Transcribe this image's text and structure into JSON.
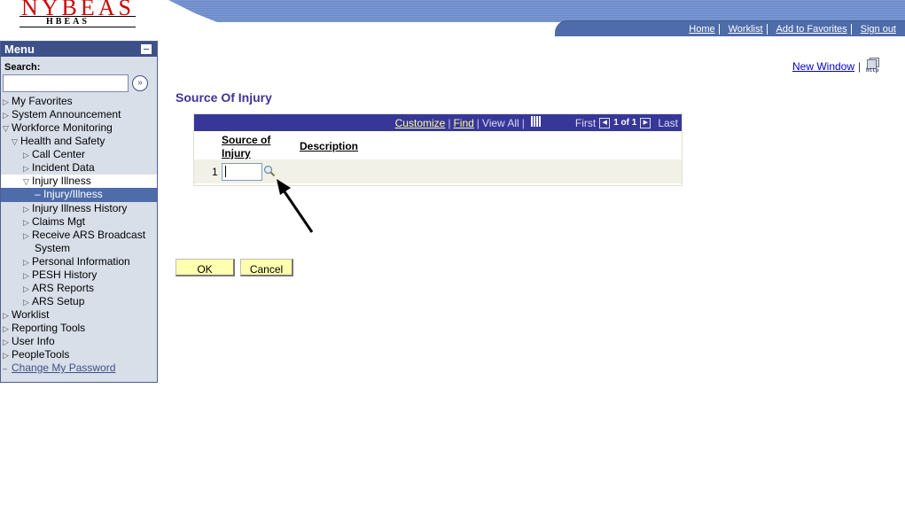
{
  "header": {
    "logo_main": "NYBEAS",
    "logo_sub": "HBEAS",
    "nav_links": [
      "Home",
      "Worklist",
      "Add to Favorites",
      "Sign out"
    ]
  },
  "sidebar": {
    "title": "Menu",
    "search_label": "Search:",
    "search_value": "",
    "items": [
      {
        "label": "My Favorites",
        "level": 0,
        "state": "collapsed"
      },
      {
        "label": "System Announcement",
        "level": 0,
        "state": "collapsed"
      },
      {
        "label": "Workforce Monitoring",
        "level": 0,
        "state": "expanded"
      },
      {
        "label": "Health and Safety",
        "level": 1,
        "state": "expanded"
      },
      {
        "label": "Call Center",
        "level": 2,
        "state": "collapsed"
      },
      {
        "label": "Incident Data",
        "level": 2,
        "state": "collapsed"
      },
      {
        "label": "Injury Illness",
        "level": 2,
        "state": "expanded"
      },
      {
        "label": "Injury/Illness",
        "level": 3,
        "state": "selected"
      },
      {
        "label": "Injury Illness History",
        "level": 2,
        "state": "collapsed"
      },
      {
        "label": "Claims Mgt",
        "level": 2,
        "state": "collapsed"
      },
      {
        "label": "Receive ARS Broadcast",
        "level": 2,
        "state": "collapsed"
      },
      {
        "label": "System",
        "level": 2,
        "state": "continuation"
      },
      {
        "label": "Personal Information",
        "level": 2,
        "state": "collapsed"
      },
      {
        "label": "PESH History",
        "level": 2,
        "state": "collapsed"
      },
      {
        "label": "ARS Reports",
        "level": 2,
        "state": "collapsed"
      },
      {
        "label": "ARS Setup",
        "level": 2,
        "state": "collapsed"
      },
      {
        "label": "Worklist",
        "level": 0,
        "state": "collapsed"
      },
      {
        "label": "Reporting Tools",
        "level": 0,
        "state": "collapsed"
      },
      {
        "label": "User Info",
        "level": 0,
        "state": "collapsed"
      },
      {
        "label": "PeopleTools",
        "level": 0,
        "state": "collapsed"
      },
      {
        "label": "Change My Password",
        "level": 0,
        "state": "link"
      }
    ]
  },
  "content": {
    "new_window": "New Window",
    "http_label": "http",
    "page_title": "Source Of Injury",
    "grid": {
      "customize": "Customize",
      "find": "Find",
      "view_all": "View All",
      "first": "First",
      "count": "1 of 1",
      "last": "Last",
      "columns": [
        "Source of Injury",
        "Description"
      ],
      "rows": [
        {
          "num": "1",
          "source_of_injury": "",
          "description": ""
        }
      ]
    },
    "ok_label": "OK",
    "cancel_label": "Cancel"
  }
}
